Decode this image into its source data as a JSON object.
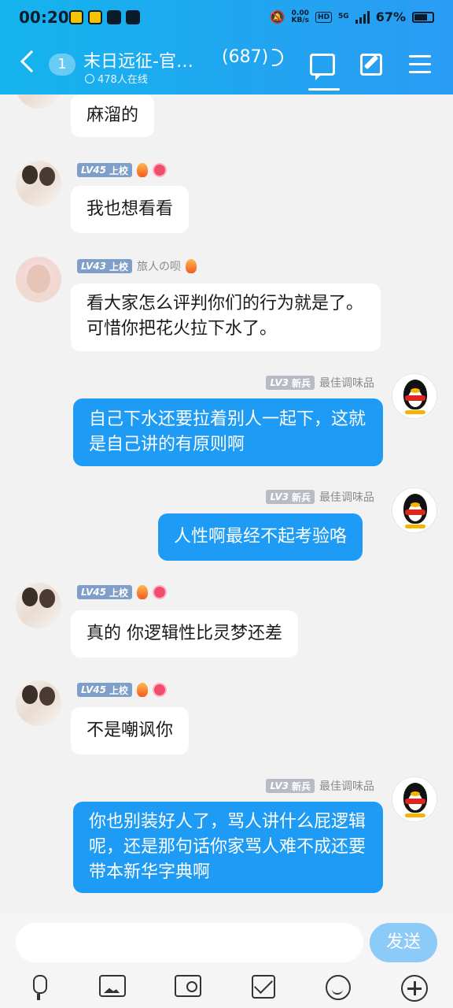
{
  "status_bar": {
    "time": "00:20",
    "net_speed_value": "0.00",
    "net_speed_unit": "KB/s",
    "hd_label": "HD",
    "network_label": "5G",
    "battery": "67%"
  },
  "header": {
    "unread_count": "1",
    "group_name": "末日远征-官…",
    "member_count": "(687)",
    "online": "478人在线"
  },
  "messages": [
    {
      "text": "麻溜的"
    },
    {
      "level": "LV45",
      "rank": "上校",
      "name": "",
      "text": "我也想看看"
    },
    {
      "level": "LV43",
      "rank": "上校",
      "name": "旅人の呗",
      "text": "看大家怎么评判你们的行为就是了。可惜你把花火拉下水了。"
    },
    {
      "level": "LV3",
      "rank": "新兵",
      "name": "最佳调味品",
      "text": "自己下水还要拉着别人一起下，这就是自己讲的有原则啊"
    },
    {
      "level": "LV3",
      "rank": "新兵",
      "name": "最佳调味品",
      "text": "人性啊最经不起考验咯"
    },
    {
      "level": "LV45",
      "rank": "上校",
      "name": "",
      "text": "真的 你逻辑性比灵梦还差"
    },
    {
      "level": "LV45",
      "rank": "上校",
      "name": "",
      "text": "不是嘲讽你"
    },
    {
      "level": "LV3",
      "rank": "新兵",
      "name": "最佳调味品",
      "text": "你也别装好人了，骂人讲什么屁逻辑呢，还是那句话你家骂人难不成还要带本新华字典啊"
    }
  ],
  "input_bar": {
    "placeholder": "",
    "send_label": "发送"
  }
}
